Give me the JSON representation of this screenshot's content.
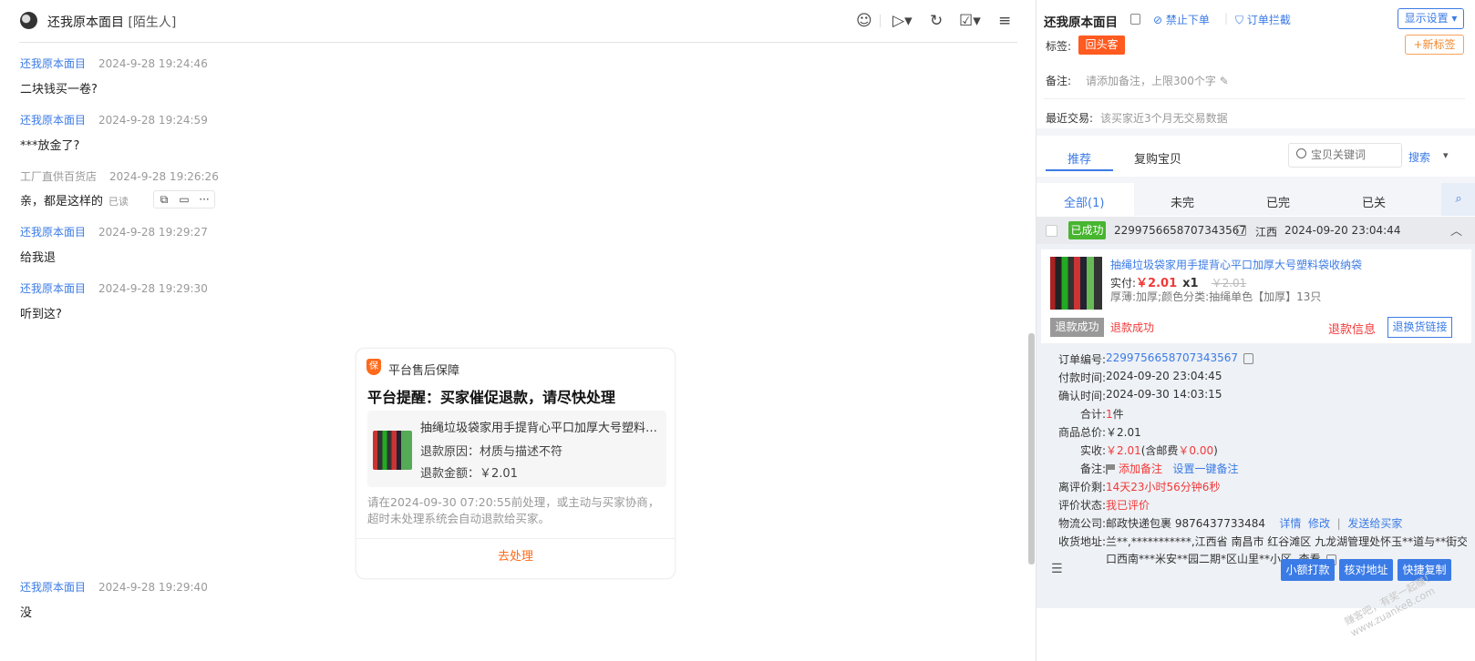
{
  "chat": {
    "header": {
      "name": "还我原本面目",
      "tag": "[陌生人]"
    },
    "messages": [
      {
        "sender": "还我原本面目",
        "time": "2024-9-28 19:24:46",
        "text": "二块钱买一卷?"
      },
      {
        "sender": "还我原本面目",
        "time": "2024-9-28 19:24:59",
        "text": "***放金了?"
      },
      {
        "sender": "工厂直供百货店",
        "time": "2024-9-28 19:26:26",
        "text": "亲，都是这样的",
        "status": "已读"
      },
      {
        "sender": "还我原本面目",
        "time": "2024-9-28 19:29:27",
        "text": "给我退"
      },
      {
        "sender": "还我原本面目",
        "time": "2024-9-28 19:29:30",
        "text": "听到这?"
      },
      {
        "sender": "还我原本面目",
        "time": "2024-9-28 19:29:40",
        "text": "没"
      }
    ],
    "card": {
      "badge": "保",
      "source": "平台售后保障",
      "title": "平台提醒：买家催促退款，请尽快处理",
      "goods_name": "抽绳垃圾袋家用手提背心平口加厚大号塑料…",
      "reason": "退款原因：材质与描述不符",
      "amount": "退款金额：￥2.01",
      "note": "请在2024-09-30 07:20:55前处理，或主动与买家协商，超时未处理系统会自动退款给买家。",
      "action": "去处理"
    }
  },
  "side": {
    "buyer_name": "还我原本面目",
    "links": {
      "forbid": "禁止下单",
      "intercept": "订单拦截"
    },
    "display_settings": "显示设置",
    "tag_label": "标签:",
    "tag_value": "回头客",
    "new_tag": "+新标签",
    "remark_label": "备注:",
    "remark_placeholder": "请添加备注，上限300个字",
    "recent_label": "最近交易:",
    "recent_value": "该买家近3个月无交易数据",
    "tabs": {
      "recommend": "推荐",
      "rebuy": "复购宝贝"
    },
    "search": {
      "placeholder": "宝贝关键词",
      "button": "搜索"
    },
    "order_tabs": [
      "全部(1)",
      "未完",
      "已完",
      "已关"
    ],
    "order": {
      "status": "已成功",
      "no": "2299756658707343567",
      "region": "江西",
      "time": "2024-09-20 23:04:44",
      "goods_name": "抽绳垃圾袋家用手提背心平口加厚大号塑料袋收纳袋",
      "paid_label": "实付:",
      "paid": "￥2.01",
      "qty": "x1",
      "orig_price": "￥2.01",
      "sku": "厚薄:加厚;颜色分类:抽绳单色【加厚】13只",
      "refund_badge": "退款成功",
      "refund_text": "退款成功",
      "refund_info": "退款信息",
      "exchange_btn": "退换货链接",
      "details": {
        "order_no_label": "订单编号:",
        "order_no": "2299756658707343567",
        "pay_time_label": "付款时间:",
        "pay_time": "2024-09-20 23:04:45",
        "confirm_time_label": "确认时间:",
        "confirm_time": "2024-09-30 14:03:15",
        "total_label": "合计:",
        "total_num": "1",
        "total_unit": "件",
        "goods_total_label": "商品总价:",
        "goods_total": "￥2.01",
        "received_label": "实收:",
        "received": "￥2.01",
        "postage_prefix": "(含邮费",
        "postage": "￥0.00",
        "postage_suffix": ")",
        "note_label": "备注:",
        "add_note": "添加备注",
        "set_note": "设置一键备注",
        "review_left_label": "离评价剩:",
        "review_left": "14天23小时56分钟6秒",
        "review_status_label": "评价状态:",
        "review_status": "我已评价",
        "logistics_label": "物流公司:",
        "logistics": "邮政快递包裹 9876437733484",
        "logistics_detail": "详情",
        "logistics_edit": "修改",
        "logistics_send": "发送给买家",
        "address_label": "收货地址:",
        "address_line1": "兰**,***********,江西省 南昌市 红谷滩区 九龙湖管理处怀玉**道与**街交叉",
        "address_line2": "口西南***米安**园二期*区山里**小区,",
        "address_view": "查看"
      },
      "buttons": {
        "small_pay": "小额打款",
        "check_addr": "核对地址",
        "quick_copy": "快捷复制"
      }
    }
  },
  "watermark": "赚客吧，有奖一起赚！ www.zuanke8.com",
  "colors": {
    "accent": "#3b7be6",
    "alert": "#f03a3a",
    "tag": "#ff5a1f",
    "success": "#47b52f"
  }
}
